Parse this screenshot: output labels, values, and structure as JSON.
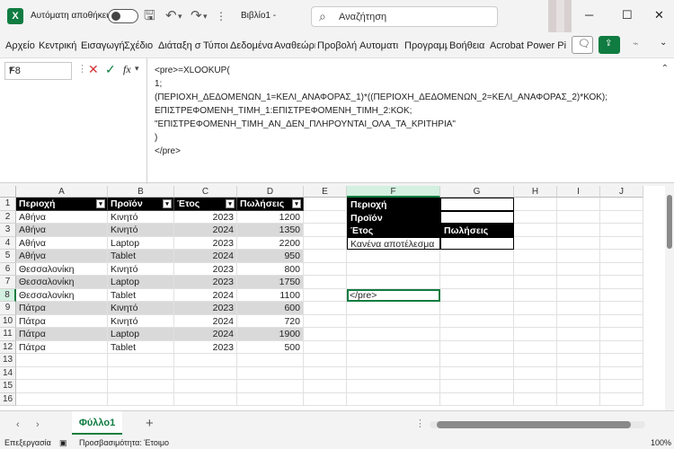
{
  "title_bar": {
    "autosave_label": "Αυτόματη αποθήκευση",
    "document_title": "Βιβλίο1  -",
    "search_placeholder": "Αναζήτηση"
  },
  "menu": [
    "Αρχείο",
    "Κεντρική",
    "Εισαγωγή",
    "Σχέδιο",
    "Διάταξη σ",
    "Τύποι",
    "Δεδομένα",
    "Αναθεώρη",
    "Προβολή",
    "Αυτοματι",
    "Προγραμμ",
    "Βοήθεια",
    "Acrobat",
    "Power Pivot"
  ],
  "formula_bar": {
    "name_box": "F8",
    "fx": "fx",
    "lines": [
      "<pre>=XLOOKUP(",
      "1;",
      "(ΠΕΡΙΟΧΗ_ΔΕΔΟΜΕΝΩΝ_1=ΚΕΛΙ_ΑΝΑΦΟΡΑΣ_1)*((ΠΕΡΙΟΧΗ_ΔΕΔΟΜΕΝΩΝ_2=ΚΕΛΙ_ΑΝΑΦΟΡΑΣ_2)*ΚΟΚ);",
      "ΕΠΙΣΤΡΕΦΟΜΕΝΗ_ΤΙΜΗ_1:ΕΠΙΣΤΡΕΦΟΜΕΝΗ_ΤΙΜΗ_2:ΚΟΚ;",
      "\"ΕΠΙΣΤΡΕΦΟΜΕΝΗ_ΤΙΜΗ_ΑΝ_ΔΕΝ_ΠΛΗΡΟΥΝΤΑΙ_ΟΛΑ_ΤΑ_ΚΡΙΤΗΡΙΑ\"",
      ")",
      "</pre>"
    ]
  },
  "columns": [
    "A",
    "B",
    "C",
    "D",
    "E",
    "F",
    "G",
    "H",
    "I",
    "J"
  ],
  "rows": [
    "1",
    "2",
    "3",
    "4",
    "5",
    "6",
    "7",
    "8",
    "9",
    "10",
    "11",
    "12",
    "13",
    "14",
    "15",
    "16"
  ],
  "table": {
    "headers": [
      "Περιοχή",
      "Προϊόν",
      "Έτος",
      "Πωλήσεις"
    ],
    "rows": [
      [
        "Αθήνα",
        "Κινητό",
        "2023",
        "1200"
      ],
      [
        "Αθήνα",
        "Κινητό",
        "2024",
        "1350"
      ],
      [
        "Αθήνα",
        "Laptop",
        "2023",
        "2200"
      ],
      [
        "Αθήνα",
        "Tablet",
        "2024",
        "950"
      ],
      [
        "Θεσσαλονίκη",
        "Κινητό",
        "2023",
        "800"
      ],
      [
        "Θεσσαλονίκη",
        "Laptop",
        "2023",
        "1750"
      ],
      [
        "Θεσσαλονίκη",
        "Tablet",
        "2024",
        "1100"
      ],
      [
        "Πάτρα",
        "Κινητό",
        "2023",
        "600"
      ],
      [
        "Πάτρα",
        "Κινητό",
        "2024",
        "720"
      ],
      [
        "Πάτρα",
        "Laptop",
        "2024",
        "1900"
      ],
      [
        "Πάτρα",
        "Tablet",
        "2023",
        "500"
      ]
    ]
  },
  "criteria": {
    "label_region": "Περιοχή",
    "label_product": "Προϊόν",
    "result_year": "Έτος",
    "result_sales": "Πωλήσεις",
    "no_result": "Κανένα αποτέλεσμα",
    "f8_value": "</pre>"
  },
  "sheet_tab": "Φύλλο1",
  "status": {
    "mode": "Επεξεργασία",
    "accessibility": "Προσβασιμότητα: Έτοιμο",
    "zoom": "100%"
  },
  "colors": {
    "accent": "#107c41",
    "header_fill": "#000000",
    "band_fill": "#d9d9d9"
  }
}
